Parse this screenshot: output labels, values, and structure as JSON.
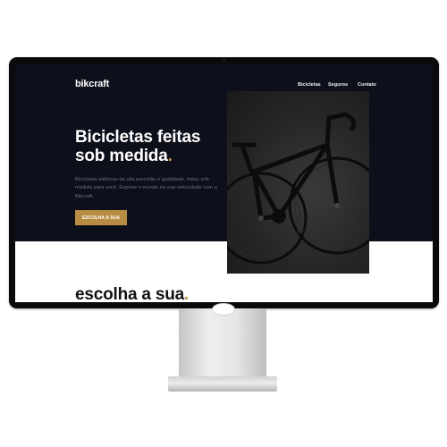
{
  "site": {
    "logo": "bikcraft",
    "nav": [
      "Bicicletas",
      "Seguros",
      "Contato"
    ]
  },
  "hero": {
    "title_line1": "Bicicletas feitas",
    "title_line2": "sob medida",
    "title_dot": ".",
    "description": "Bicicletas elétricas de alta precisão e qualidade, feitas sob medida para você. Explore o mundo na sua velocidade com a Bikcraft.",
    "cta_label": "ESCOLHA A SUA"
  },
  "section": {
    "title": "escolha a sua",
    "title_dot": "."
  },
  "colors": {
    "hero_background": "#0d0f1a",
    "accent": "#b98c43",
    "monitor_bezel": "#0a0a0c"
  },
  "icons": {
    "hero_image": "bicycle-photo"
  }
}
